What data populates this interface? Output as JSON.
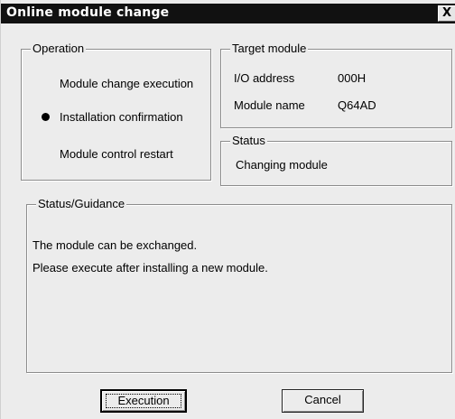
{
  "window": {
    "title": "Online module change",
    "close_glyph": "X"
  },
  "operation": {
    "legend": "Operation",
    "items": [
      {
        "label": "Module change execution",
        "selected": false
      },
      {
        "label": "Installation confirmation",
        "selected": true
      },
      {
        "label": "Module control restart",
        "selected": false
      }
    ]
  },
  "target_module": {
    "legend": "Target module",
    "io_address_label": "I/O address",
    "io_address_value": "000H",
    "module_name_label": "Module name",
    "module_name_value": "Q64AD"
  },
  "status": {
    "legend": "Status",
    "text": "Changing module"
  },
  "guidance": {
    "legend": "Status/Guidance",
    "lines": [
      "The module can be exchanged.",
      "Please execute after installing a new module."
    ]
  },
  "buttons": {
    "execution": "Execution",
    "cancel": "Cancel"
  },
  "colors": {
    "titlebar": "#111111",
    "dialog_bg": "#ececec"
  }
}
